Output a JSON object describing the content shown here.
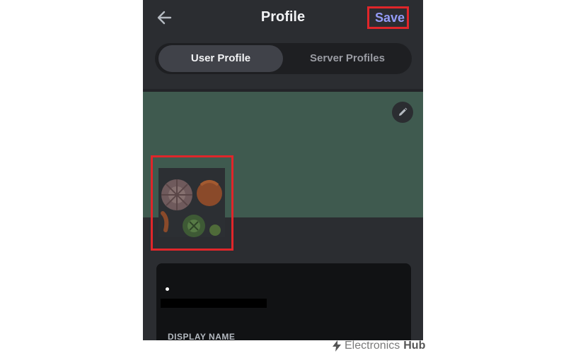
{
  "header": {
    "back_icon": "arrow-left-icon",
    "title": "Profile",
    "save_label": "Save"
  },
  "tabs": [
    {
      "label": "User Profile",
      "active": true
    },
    {
      "label": "Server Profiles",
      "active": false
    }
  ],
  "banner": {
    "color": "#3f5a4f",
    "edit_icon": "pencil-icon"
  },
  "profile_card": {
    "section_label": "DISPLAY NAME"
  },
  "watermark": {
    "brand_light": "Electronics",
    "brand_bold": "Hub"
  },
  "colors": {
    "background": "#2b2d31",
    "accent": "#949cf7",
    "highlight": "#e0262a"
  }
}
